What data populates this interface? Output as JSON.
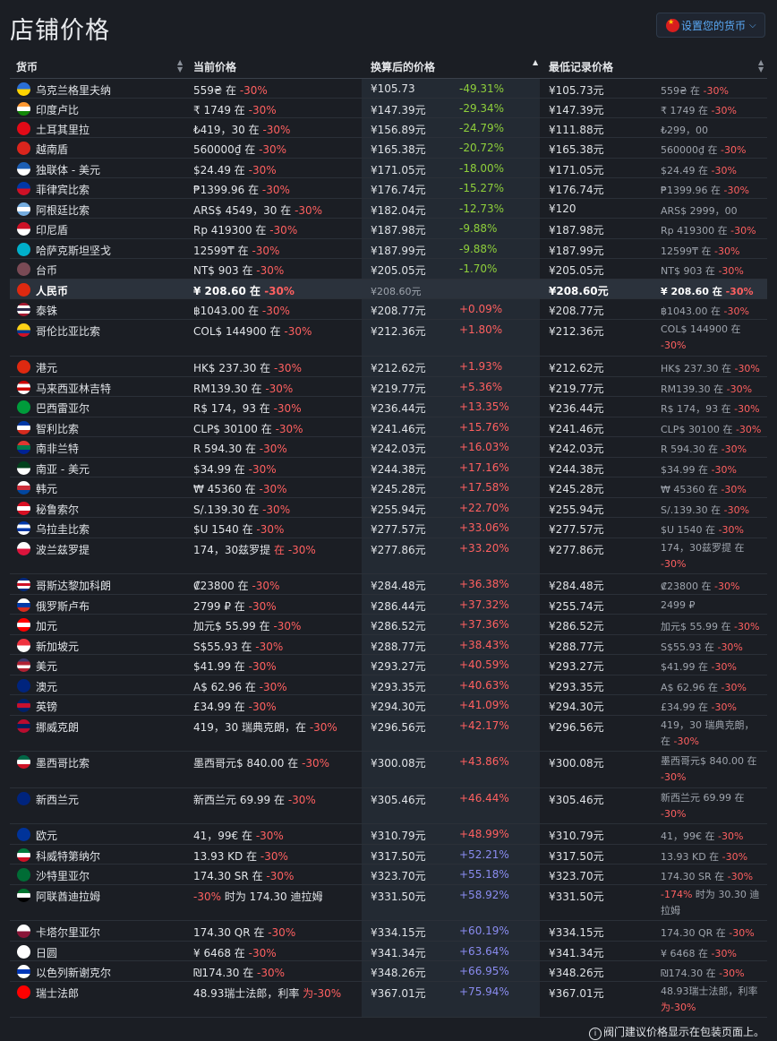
{
  "page_title": "店铺价格",
  "currency_button": "设置您的货币",
  "columns": [
    "货币",
    "当前价格",
    "换算后的价格",
    "最低记录价格"
  ],
  "footnote": "阀门建议价格显示在包装页面上。",
  "rows": [
    {
      "name": "乌克兰格里夫纳",
      "price": "559₴ 在",
      "disc": "-30%",
      "conv": "¥105.73",
      "pct": "-49.31%",
      "low": "¥105.73元",
      "lowp": "559₴ 在",
      "lowd": "-30%",
      "flag": [
        "#2a6fd6",
        "#ffd400"
      ],
      "pc": "green",
      "h": 22
    },
    {
      "name": "印度卢比",
      "price": "₹ 1749 在",
      "disc": "-30%",
      "conv": "¥147.39元",
      "pct": "-29.34%",
      "low": "¥147.39元",
      "lowp": "₹ 1749 在",
      "lowd": "-30%",
      "flag": [
        "#ff9933",
        "#ffffff",
        "#138808"
      ],
      "pc": "green",
      "h": 22
    },
    {
      "name": "土耳其里拉",
      "price": "₺419，30 在",
      "disc": "-30%",
      "conv": "¥156.89元",
      "pct": "-24.79%",
      "low": "¥111.88元",
      "lowp": "₺299，00",
      "lowd": "",
      "flag": [
        "#e30a17"
      ],
      "pc": "green",
      "h": 22
    },
    {
      "name": "越南盾",
      "price": "560000₫ 在",
      "disc": "-30%",
      "conv": "¥165.38元",
      "pct": "-20.72%",
      "low": "¥165.38元",
      "lowp": "560000₫ 在",
      "lowd": "-30%",
      "flag": [
        "#da251d"
      ],
      "pc": "green",
      "h": 23
    },
    {
      "name": "独联体 - 美元",
      "price": "$24.49 在",
      "disc": "-30%",
      "conv": "¥171.05元",
      "pct": "-18.00%",
      "low": "¥171.05元",
      "lowp": "$24.49 在",
      "lowd": "-30%",
      "flag": [
        "#1c5fb5",
        "#ffffff"
      ],
      "pc": "green",
      "h": 22
    },
    {
      "name": "菲律宾比索",
      "price": "₱1399.96 在",
      "disc": "-30%",
      "conv": "¥176.74元",
      "pct": "-15.27%",
      "low": "¥176.74元",
      "lowp": "₱1399.96 在",
      "lowd": "-30%",
      "flag": [
        "#0038a8",
        "#ce1126"
      ],
      "pc": "green",
      "h": 23
    },
    {
      "name": "阿根廷比索",
      "price": "ARS$ 4549，30 在",
      "disc": "-30%",
      "conv": "¥182.04元",
      "pct": "-12.73%",
      "low": "¥120",
      "lowp": "ARS$ 2999，00",
      "lowd": "",
      "flag": [
        "#74acdf",
        "#ffffff",
        "#74acdf"
      ],
      "pc": "green",
      "h": 22
    },
    {
      "name": "印尼盾",
      "price": "Rp 419300 在",
      "disc": "-30%",
      "conv": "¥187.98元",
      "pct": "-9.88%",
      "low": "¥187.98元",
      "lowp": "Rp 419300 在",
      "lowd": "-30%",
      "flag": [
        "#ce1126",
        "#ffffff"
      ],
      "pc": "green",
      "h": 23
    },
    {
      "name": "哈萨克斯坦坚戈",
      "price": "12599₸ 在",
      "disc": "-30%",
      "conv": "¥187.99元",
      "pct": "-9.88%",
      "low": "¥187.99元",
      "lowp": "12599₸ 在",
      "lowd": "-30%",
      "flag": [
        "#00afca"
      ],
      "pc": "green",
      "h": 22
    },
    {
      "name": "台币",
      "price": "NT$ 903 在",
      "disc": "-30%",
      "conv": "¥205.05元",
      "pct": "-1.70%",
      "low": "¥205.05元",
      "lowp": "NT$ 903 在",
      "lowd": "-30%",
      "flag": [
        "#7a4a55"
      ],
      "pc": "green",
      "h": 23
    },
    {
      "name": "人民币",
      "price": "¥ 208.60 在",
      "disc": "-30%",
      "conv": "¥208.60元",
      "pct": "",
      "low": "¥208.60元",
      "lowp": "¥ 208.60 在",
      "lowd": "-30%",
      "flag": [
        "#de2910"
      ],
      "pc": "",
      "h": 22,
      "hl": true
    },
    {
      "name": "泰铢",
      "price": "฿1043.00 在",
      "disc": "-30%",
      "conv": "¥208.77元",
      "pct": "+0.09%",
      "low": "¥208.77元",
      "lowp": "฿1043.00 在",
      "lowd": "-30%",
      "flag": [
        "#a51931",
        "#ffffff",
        "#2d2a4a",
        "#ffffff",
        "#a51931"
      ],
      "pc": "red",
      "h": 23
    },
    {
      "name": "哥伦比亚比索",
      "price": "COL$ 144900 在",
      "disc": "-30%",
      "conv": "¥212.36元",
      "pct": "+1.80%",
      "low": "¥212.36元",
      "lowp": "COL$ 144900 在",
      "lowd": "-30%",
      "flag": [
        "#fcd116",
        "#fcd116",
        "#003893",
        "#ce1126"
      ],
      "pc": "red",
      "h": 41,
      "wrapLow": true
    },
    {
      "name": "港元",
      "price": "HK$ 237.30 在",
      "disc": "-30%",
      "conv": "¥212.62元",
      "pct": "+1.93%",
      "low": "¥212.62元",
      "lowp": "HK$ 237.30 在",
      "lowd": "-30%",
      "flag": [
        "#de2910"
      ],
      "pc": "red",
      "h": 23
    },
    {
      "name": "马来西亚林吉特",
      "price": "RM139.30 在",
      "disc": "-30%",
      "conv": "¥219.77元",
      "pct": "+5.36%",
      "low": "¥219.77元",
      "lowp": "RM139.30 在",
      "lowd": "-30%",
      "flag": [
        "#cc0001",
        "#ffffff",
        "#cc0001",
        "#ffffff"
      ],
      "pc": "red",
      "h": 22
    },
    {
      "name": "巴西雷亚尔",
      "price": "R$ 174，93 在",
      "disc": "-30%",
      "conv": "¥236.44元",
      "pct": "+13.35%",
      "low": "¥236.44元",
      "lowp": "R$ 174，93 在",
      "lowd": "-30%",
      "flag": [
        "#009c3b"
      ],
      "pc": "red",
      "h": 23
    },
    {
      "name": "智利比索",
      "price": "CLP$ 30100 在",
      "disc": "-30%",
      "conv": "¥241.46元",
      "pct": "+15.76%",
      "low": "¥241.46元",
      "lowp": "CLP$ 30100 在",
      "lowd": "-30%",
      "flag": [
        "#0039a6",
        "#ffffff",
        "#d52b1e"
      ],
      "pc": "red",
      "h": 22
    },
    {
      "name": "南非兰特",
      "price": "R 594.30 在",
      "disc": "-30%",
      "conv": "¥242.03元",
      "pct": "+16.03%",
      "low": "¥242.03元",
      "lowp": "R 594.30 在",
      "lowd": "-30%",
      "flag": [
        "#de3831",
        "#007a4d",
        "#002395"
      ],
      "pc": "red",
      "h": 23
    },
    {
      "name": "南亚 - 美元",
      "price": "$34.99 在",
      "disc": "-30%",
      "conv": "¥244.38元",
      "pct": "+17.16%",
      "low": "¥244.38元",
      "lowp": "$34.99 在",
      "lowd": "-30%",
      "flag": [
        "#01411c",
        "#ffffff"
      ],
      "pc": "red",
      "h": 22
    },
    {
      "name": "韩元",
      "price": "₩ 45360 在",
      "disc": "-30%",
      "conv": "¥245.28元",
      "pct": "+17.58%",
      "low": "¥245.28元",
      "lowp": "₩ 45360 在",
      "lowd": "-30%",
      "flag": [
        "#ffffff",
        "#cd2e3a",
        "#0047a0"
      ],
      "pc": "red",
      "h": 23
    },
    {
      "name": "秘鲁索尔",
      "price": "S/.139.30 在",
      "disc": "-30%",
      "conv": "¥255.94元",
      "pct": "+22.70%",
      "low": "¥255.94元",
      "lowp": "S/.139.30 在",
      "lowd": "-30%",
      "flag": [
        "#d91023",
        "#ffffff",
        "#d91023"
      ],
      "pc": "red",
      "h": 22
    },
    {
      "name": "乌拉圭比索",
      "price": "$U 1540 在",
      "disc": "-30%",
      "conv": "¥277.57元",
      "pct": "+33.06%",
      "low": "¥277.57元",
      "lowp": "$U 1540 在",
      "lowd": "-30%",
      "flag": [
        "#0038a8",
        "#ffffff",
        "#0038a8",
        "#ffffff"
      ],
      "pc": "red",
      "h": 23
    },
    {
      "name": "波兰兹罗提",
      "price": "174，30兹罗提",
      "disc": "在 -30%",
      "conv": "¥277.86元",
      "pct": "+33.20%",
      "low": "¥277.86元",
      "lowp": "174，30兹罗提 在",
      "lowd": "-30%",
      "flag": [
        "#ffffff",
        "#dc143c"
      ],
      "pc": "red",
      "h": 40,
      "wrapLow": true
    },
    {
      "name": "哥斯达黎加科朗",
      "price": "₡23800 在",
      "disc": "-30%",
      "conv": "¥284.48元",
      "pct": "+36.38%",
      "low": "¥284.48元",
      "lowp": "₡23800 在",
      "lowd": "-30%",
      "flag": [
        "#002b7f",
        "#ffffff",
        "#ce1126",
        "#ffffff",
        "#002b7f"
      ],
      "pc": "red",
      "h": 23
    },
    {
      "name": "俄罗斯卢布",
      "price": "2799 ₽ 在",
      "disc": "-30%",
      "conv": "¥286.44元",
      "pct": "+37.32%",
      "low": "¥255.74元",
      "lowp": "2499 ₽",
      "lowd": "",
      "flag": [
        "#ffffff",
        "#0039a6",
        "#d52b1e"
      ],
      "pc": "red",
      "h": 22
    },
    {
      "name": "加元",
      "price": "加元$ 55.99 在",
      "disc": "-30%",
      "conv": "¥286.52元",
      "pct": "+37.36%",
      "low": "¥286.52元",
      "lowp": "加元$ 55.99 在",
      "lowd": "-30%",
      "flag": [
        "#ff0000",
        "#ffffff",
        "#ff0000"
      ],
      "pc": "red",
      "h": 23
    },
    {
      "name": "新加坡元",
      "price": "S$55.93 在",
      "disc": "-30%",
      "conv": "¥288.77元",
      "pct": "+38.43%",
      "low": "¥288.77元",
      "lowp": "S$55.93 在",
      "lowd": "-30%",
      "flag": [
        "#ef3340",
        "#ffffff"
      ],
      "pc": "red",
      "h": 22
    },
    {
      "name": "美元",
      "price": "$41.99 在",
      "disc": "-30%",
      "conv": "¥293.27元",
      "pct": "+40.59%",
      "low": "¥293.27元",
      "lowp": "$41.99 在",
      "lowd": "-30%",
      "flag": [
        "#3c3b6e",
        "#b22234",
        "#ffffff",
        "#b22234"
      ],
      "pc": "red",
      "h": 23
    },
    {
      "name": "澳元",
      "price": "A$ 62.96 在",
      "disc": "-30%",
      "conv": "¥293.35元",
      "pct": "+40.63%",
      "low": "¥293.35元",
      "lowp": "A$ 62.96 在",
      "lowd": "-30%",
      "flag": [
        "#00247d"
      ],
      "pc": "red",
      "h": 22
    },
    {
      "name": "英镑",
      "price": "£34.99 在",
      "disc": "-30%",
      "conv": "¥294.30元",
      "pct": "+41.09%",
      "low": "¥294.30元",
      "lowp": "£34.99 在",
      "lowd": "-30%",
      "flag": [
        "#012169",
        "#c8102e",
        "#012169"
      ],
      "pc": "red",
      "h": 23
    },
    {
      "name": "挪威克朗",
      "price": "419，30 瑞典克朗，在",
      "disc": "-30%",
      "conv": "¥296.56元",
      "pct": "+42.17%",
      "low": "¥296.56元",
      "lowp": "419，30 瑞典克朗，在",
      "lowd": "-30%",
      "flag": [
        "#ba0c2f",
        "#00205b",
        "#ba0c2f"
      ],
      "pc": "red",
      "h": 40,
      "wrapLow": true
    },
    {
      "name": "墨西哥比索",
      "price": "墨西哥元$ 840.00 在",
      "disc": "-30%",
      "conv": "¥300.08元",
      "pct": "+43.86%",
      "low": "¥300.08元",
      "lowp": "墨西哥元$ 840.00 在",
      "lowd": "-30%",
      "flag": [
        "#006847",
        "#ffffff",
        "#ce1126"
      ],
      "pc": "red",
      "h": 41,
      "wrapLow": true
    },
    {
      "name": "新西兰元",
      "price": "新西兰元 69.99 在",
      "disc": "-30%",
      "conv": "¥305.46元",
      "pct": "+46.44%",
      "low": "¥305.46元",
      "lowp": "新西兰元 69.99 在",
      "lowd": "-30%",
      "flag": [
        "#00247d"
      ],
      "pc": "red",
      "h": 40,
      "wrapLow": true
    },
    {
      "name": "欧元",
      "price": "41，99€ 在",
      "disc": "-30%",
      "conv": "¥310.79元",
      "pct": "+48.99%",
      "low": "¥310.79元",
      "lowp": "41，99€ 在",
      "lowd": "-30%",
      "flag": [
        "#003399"
      ],
      "pc": "red",
      "h": 23
    },
    {
      "name": "科威特第纳尔",
      "price": "13.93 KD 在",
      "disc": "-30%",
      "conv": "¥317.50元",
      "pct": "+52.21%",
      "low": "¥317.50元",
      "lowp": "13.93 KD 在",
      "lowd": "-30%",
      "flag": [
        "#007a3d",
        "#ffffff",
        "#ce1126"
      ],
      "pc": "purple",
      "h": 22
    },
    {
      "name": "沙特里亚尔",
      "price": "174.30 SR 在",
      "disc": "-30%",
      "conv": "¥323.70元",
      "pct": "+55.18%",
      "low": "¥323.70元",
      "lowp": "174.30 SR 在",
      "lowd": "-30%",
      "flag": [
        "#006c35"
      ],
      "pc": "purple",
      "h": 23
    },
    {
      "name": "阿联酋迪拉姆",
      "price": "",
      "disc": "-30%",
      "priceAfter": " 时为 174.30 迪拉姆",
      "conv": "¥331.50元",
      "pct": "+58.92%",
      "low": "¥331.50元",
      "lowp": "",
      "lowd": "-174%",
      "lowAfter": " 时为 30.30 迪拉姆",
      "flag": [
        "#00732f",
        "#ffffff",
        "#000000"
      ],
      "pc": "purple",
      "h": 40,
      "wrapLow": true,
      "discFirst": true
    },
    {
      "name": "卡塔尔里亚尔",
      "price": "174.30 QR 在",
      "disc": "-30%",
      "conv": "¥334.15元",
      "pct": "+60.19%",
      "low": "¥334.15元",
      "lowp": "174.30 QR 在",
      "lowd": "-30%",
      "flag": [
        "#ffffff",
        "#8a1538"
      ],
      "pc": "purple",
      "h": 23
    },
    {
      "name": "日圆",
      "price": "¥ 6468 在",
      "disc": "-30%",
      "conv": "¥341.34元",
      "pct": "+63.64%",
      "low": "¥341.34元",
      "lowp": "¥ 6468 在",
      "lowd": "-30%",
      "flag": [
        "#ffffff"
      ],
      "pc": "purple",
      "h": 22
    },
    {
      "name": "以色列新谢克尔",
      "price": "₪174.30 在",
      "disc": "-30%",
      "conv": "¥348.26元",
      "pct": "+66.95%",
      "low": "¥348.26元",
      "lowp": "₪174.30 在",
      "lowd": "-30%",
      "flag": [
        "#ffffff",
        "#0038b8",
        "#ffffff"
      ],
      "pc": "purple",
      "h": 23
    },
    {
      "name": "瑞士法郎",
      "price": "48.93瑞士法郎，利率",
      "disc": "为-30%",
      "conv": "¥367.01元",
      "pct": "+75.94%",
      "low": "¥367.01元",
      "lowp": "48.93瑞士法郎，利率",
      "lowd": "为-30%",
      "flag": [
        "#ff0000"
      ],
      "pc": "purple",
      "h": 40,
      "wrapLow": true
    }
  ]
}
